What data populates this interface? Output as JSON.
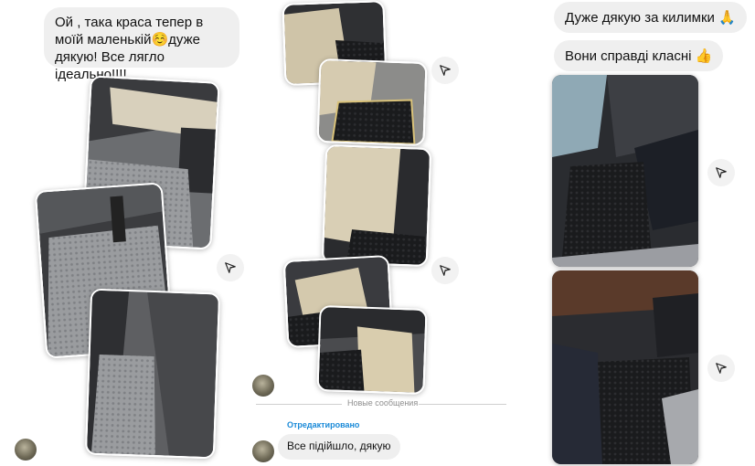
{
  "left_chat": {
    "message": "Ой , така краса тепер в моїй маленькій☺️дуже дякую! Все лягло ідеально!!!!",
    "photos": [
      "car-interior-photo-1",
      "car-interior-photo-2",
      "car-interior-photo-3"
    ]
  },
  "middle_chat": {
    "divider_label": "Новые сообщения",
    "edited_label": "Отредактировано",
    "reply": "Все підійшло, дякую",
    "photos": [
      "car-interior-photo-4",
      "car-interior-photo-5",
      "car-interior-photo-6",
      "car-interior-photo-7",
      "car-interior-photo-8"
    ]
  },
  "right_chat": {
    "message_1": "Дуже дякую за килимки 🙏",
    "message_2": "Вони справді класні 👍",
    "photos": [
      "car-interior-photo-9",
      "car-interior-photo-10"
    ]
  },
  "icons": {
    "share": "share-icon",
    "avatar": "avatar"
  },
  "colors": {
    "bubble": "#efefef",
    "edited": "#1a8ad8",
    "divider_text": "#8e8e8e"
  }
}
